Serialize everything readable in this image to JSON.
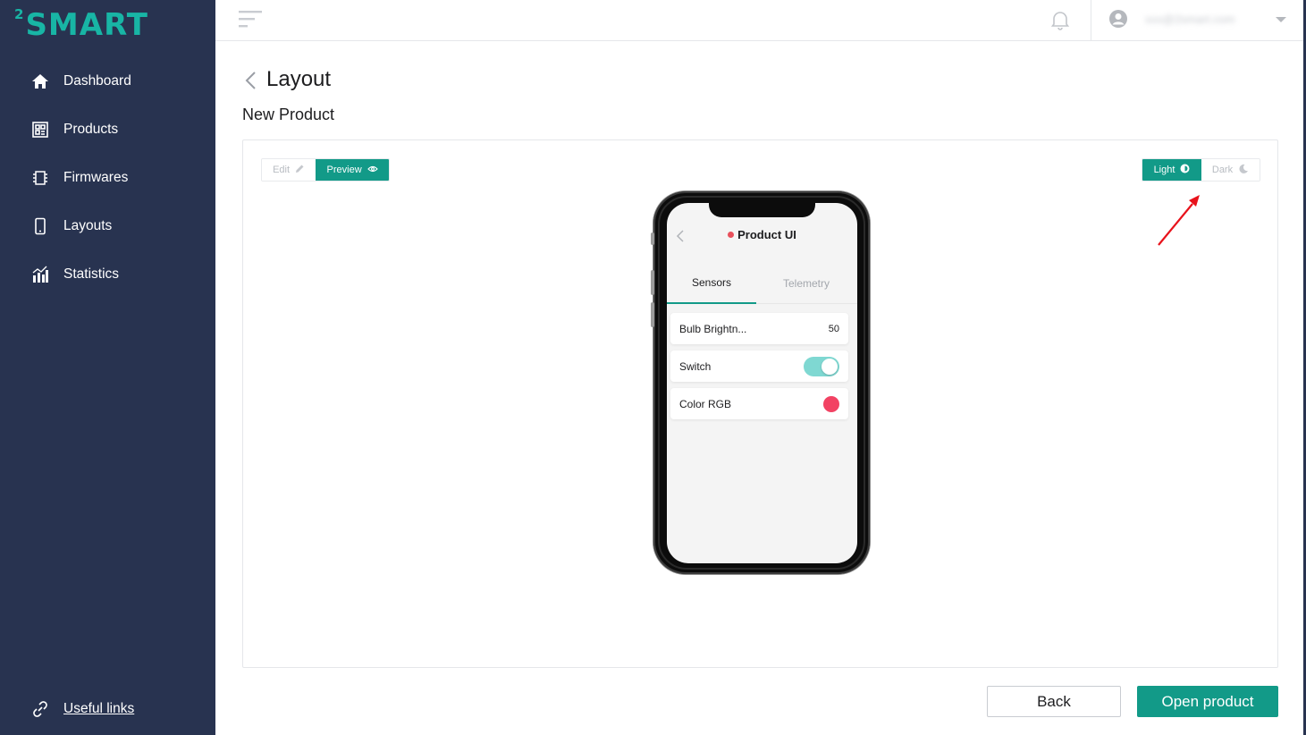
{
  "brand": {
    "logo_sup": "2",
    "logo_text": "SMART"
  },
  "sidebar": {
    "items": [
      {
        "label": "Dashboard",
        "icon": "home-icon"
      },
      {
        "label": "Products",
        "icon": "products-icon"
      },
      {
        "label": "Firmwares",
        "icon": "chip-icon"
      },
      {
        "label": "Layouts",
        "icon": "phone-icon"
      },
      {
        "label": "Statistics",
        "icon": "statistics-icon"
      }
    ],
    "useful_links": "Useful links"
  },
  "topbar": {
    "user_email": "xxx@2smart.com"
  },
  "header": {
    "title": "Layout",
    "subtitle": "New Product"
  },
  "mode_toggle": {
    "edit": "Edit",
    "preview": "Preview",
    "active": "Preview"
  },
  "theme_toggle": {
    "light": "Light",
    "dark": "Dark",
    "active": "Light"
  },
  "phone_preview": {
    "title": "Product UI",
    "tabs": [
      "Sensors",
      "Telemetry"
    ],
    "active_tab": "Sensors",
    "cards": [
      {
        "label": "Bulb Brightn...",
        "value": "50"
      },
      {
        "label": "Switch",
        "state": "on"
      },
      {
        "label": "Color RGB",
        "color": "#f24263"
      }
    ]
  },
  "actions": {
    "back": "Back",
    "open_product": "Open product"
  },
  "colors": {
    "sidebar": "#283350",
    "accent": "#129a88",
    "logo": "#18b5a5",
    "annotation_arrow": "#e8121b"
  }
}
